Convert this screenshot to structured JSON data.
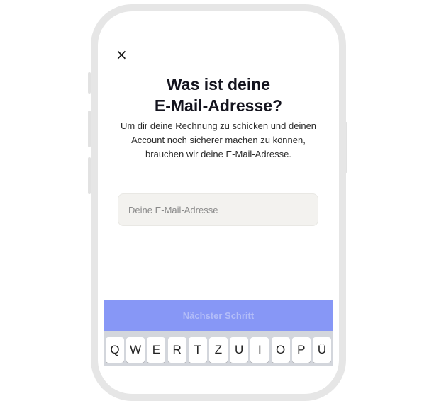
{
  "header": {
    "close_icon": "close-icon",
    "close_glyph": "×"
  },
  "content": {
    "title_line1": "Was ist deine",
    "title_line2": "E-Mail-Adresse?",
    "subtitle": "Um dir deine Rechnung zu schicken und deinen Account noch sicherer machen zu können, brauchen wir deine E-Mail-Adresse."
  },
  "email": {
    "value": "",
    "placeholder": "Deine E-Mail-Adresse"
  },
  "cta": {
    "label": "Nächster Schritt",
    "color": "#8797f6"
  },
  "keyboard": {
    "row1": [
      "Q",
      "W",
      "E",
      "R",
      "T",
      "Z",
      "U",
      "I",
      "O",
      "P",
      "Ü"
    ]
  }
}
